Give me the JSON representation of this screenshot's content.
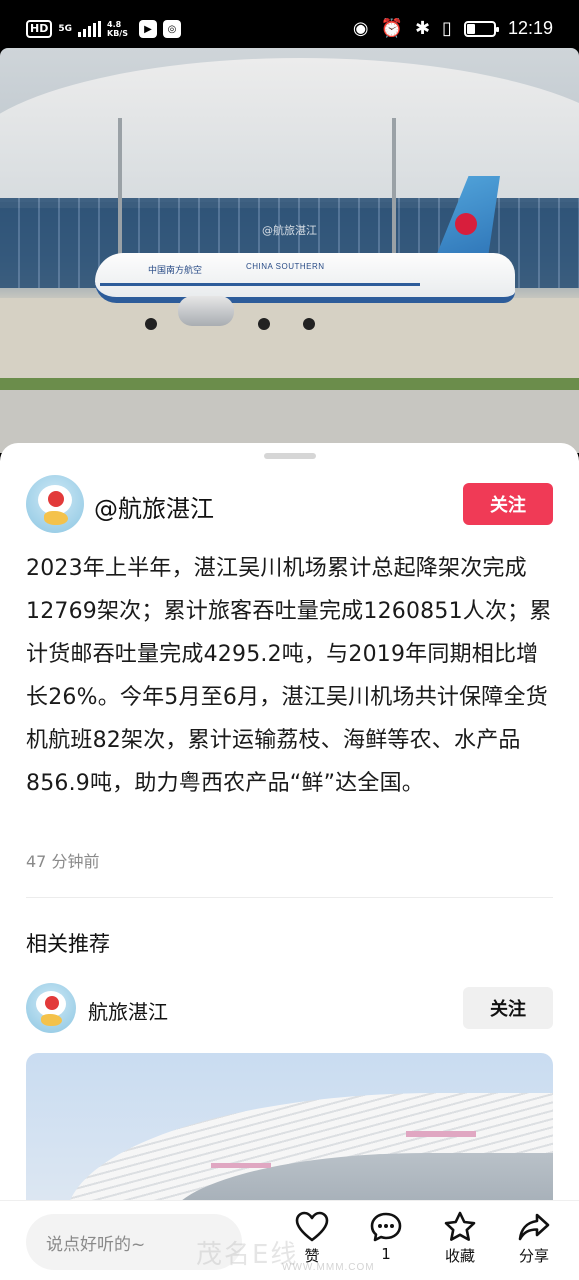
{
  "status_bar": {
    "hd": "HD",
    "network": "5G",
    "network_speed": "4.8 KB/S",
    "time": "12:19",
    "battery_level": 0.3
  },
  "post": {
    "author": "@航旅湛江",
    "follow_label": "关注",
    "text": "2023年上半年，湛江吴川机场累计总起降架次完成12769架次；累计旅客吞吐量完成1260851人次；累计货邮吞吐量完成4295.2吨，与2019年同期相比增长26%。今年5月至6月，湛江吴川机场共计保障全货机航班82架次，累计运输荔枝、海鲜等农、水产品856.9吨，助力粤西农产品“鲜”达全国。",
    "time_ago": "47 分钟前",
    "hero_watermark": "@航旅湛江",
    "plane_livery_cn": "中国南方航空",
    "plane_livery_en": "CHINA SOUTHERN"
  },
  "related": {
    "title": "相关推荐",
    "item": {
      "author": "航旅湛江",
      "follow_label": "关注"
    }
  },
  "bottom_bar": {
    "comment_placeholder": "说点好听的~",
    "like_label": "赞",
    "comment_count": "1",
    "favorite_label": "收藏",
    "share_label": "分享"
  },
  "watermark": {
    "text": "茂名E线",
    "url": "WWW.MMM.COM"
  },
  "colors": {
    "accent": "#f03a56",
    "follow_grey": "#f0f0f0"
  },
  "icons": {
    "like": "heart-icon",
    "comment": "comment-bubble-icon",
    "favorite": "star-icon",
    "share": "share-arrow-icon"
  }
}
